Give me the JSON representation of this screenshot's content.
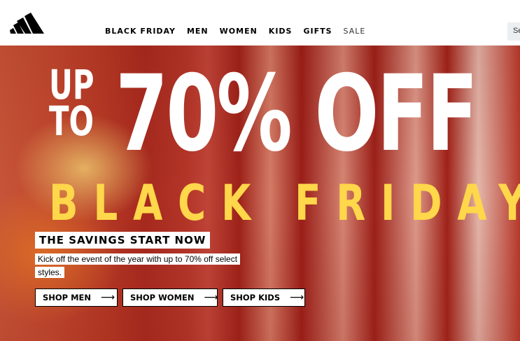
{
  "header": {
    "logo": "adidas-logo-icon",
    "nav": [
      "BLACK FRIDAY",
      "MEN",
      "WOMEN",
      "KIDS",
      "GIFTS",
      "SALE"
    ],
    "search_text": "Se"
  },
  "hero": {
    "upto_line1": "UP",
    "upto_line2": "TO",
    "percent_text": "70% OFF",
    "subtitle": "BLACK FRIDAY",
    "tagline": "THE SAVINGS START NOW",
    "description": "Kick off the event of the year with up to 70% off select styles.",
    "ctas": [
      "SHOP MEN",
      "SHOP WOMEN",
      "SHOP KIDS"
    ],
    "cta_arrow": "⟶"
  },
  "colors": {
    "accent_yellow": "#ffd74a",
    "text": "#000000",
    "hero_red": "#b73a26"
  }
}
